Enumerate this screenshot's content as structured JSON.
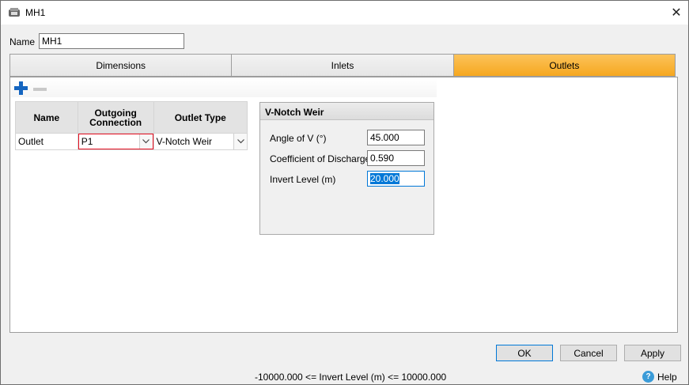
{
  "window": {
    "title": "MH1",
    "close_glyph": "✕"
  },
  "name_field": {
    "label": "Name",
    "value": "MH1"
  },
  "tabs": [
    {
      "label": "Dimensions",
      "active": false
    },
    {
      "label": "Inlets",
      "active": false
    },
    {
      "label": "Outlets",
      "active": true
    }
  ],
  "toolstrip": {
    "add_icon": "plus-icon",
    "remove_icon": "minus-icon"
  },
  "grid": {
    "headers": [
      "Name",
      "Outgoing Connection",
      "Outlet Type"
    ],
    "rows": [
      {
        "name": "Outlet",
        "connection": "P1",
        "outlet_type": "V-Notch Weir"
      }
    ]
  },
  "weir_group": {
    "title": "V-Notch Weir",
    "fields": [
      {
        "label": "Angle of V (°)",
        "value": "45.000"
      },
      {
        "label": "Coefficient of Discharge",
        "value": "0.590"
      },
      {
        "label": "Invert Level (m)",
        "value": "20.000"
      }
    ]
  },
  "buttons": {
    "ok": "OK",
    "cancel": "Cancel",
    "apply": "Apply"
  },
  "status_text": "-10000.000 <= Invert Level (m) <= 10000.000",
  "help": {
    "label": "Help",
    "glyph": "?"
  },
  "colors": {
    "active_tab": "#f6a71f",
    "focus": "#0078d7",
    "error": "#e81123",
    "add_icon": "#1565c0"
  }
}
